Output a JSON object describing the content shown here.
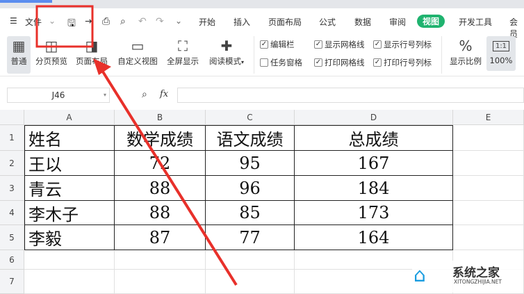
{
  "menu": {
    "file": "文件",
    "tabs": [
      "开始",
      "插入",
      "页面布局",
      "公式",
      "数据",
      "审阅",
      "视图",
      "开发工具",
      "会员"
    ],
    "active": "视图"
  },
  "ribbon": {
    "buttons": [
      "普通",
      "分页预览",
      "页面布局",
      "自定义视图",
      "全屏显示",
      "阅读模式"
    ],
    "checks": [
      {
        "label": "编辑栏",
        "checked": true
      },
      {
        "label": "显示网格线",
        "checked": true
      },
      {
        "label": "显示行号列标",
        "checked": true
      },
      {
        "label": "任务窗格",
        "checked": false
      },
      {
        "label": "打印网格线",
        "checked": true
      },
      {
        "label": "打印行号列标",
        "checked": true
      }
    ],
    "zoom_label": "显示比例",
    "zoom_100": "100%",
    "ratio": "1:1"
  },
  "formula": {
    "cell_ref": "J46",
    "fx": "fx"
  },
  "columns": [
    "A",
    "B",
    "C",
    "D",
    "E"
  ],
  "rows": [
    "1",
    "2",
    "3",
    "4",
    "5",
    "6",
    "7"
  ],
  "table": [
    [
      "姓名",
      "数学成绩",
      "语文成绩",
      "总成绩"
    ],
    [
      "王以",
      "72",
      "95",
      "167"
    ],
    [
      "青云",
      "88",
      "96",
      "184"
    ],
    [
      "李木子",
      "88",
      "85",
      "173"
    ],
    [
      "李毅",
      "87",
      "77",
      "164"
    ]
  ],
  "watermark": {
    "name": "系统之家",
    "url": "XITONGZHIJIA.NET"
  },
  "colors": {
    "accent": "#1fb36f",
    "annotation": "#e8302a"
  }
}
